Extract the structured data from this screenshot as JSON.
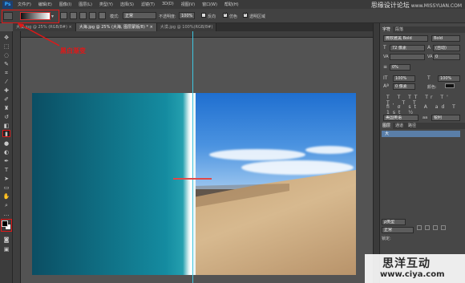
{
  "app": {
    "logo": "Ps"
  },
  "menu": [
    "文件(F)",
    "编辑(E)",
    "图像(I)",
    "图层(L)",
    "类型(Y)",
    "选择(S)",
    "滤镜(T)",
    "3D(D)",
    "视图(V)",
    "窗口(W)",
    "帮助(H)"
  ],
  "site_logo": {
    "name": "思缘设计论坛",
    "url": "www.MISSYUAN.COM"
  },
  "options": {
    "mode_label": "模式:",
    "mode_value": "正常",
    "opacity_label": "不透明度:",
    "opacity_value": "100%",
    "reverse_label": "反向",
    "dither_label": "仿色",
    "transparency_label": "透明区域"
  },
  "tabs": [
    {
      "label": "大漠.jpg @ 25% (RGB/8#) ×",
      "active": false
    },
    {
      "label": "大海.jpg @ 25% (大海, 图层蒙版/8) * ×",
      "active": true
    },
    {
      "label": "大漠.jpg @ 100%(RGB/8#)",
      "active": false
    }
  ],
  "annotation": {
    "text": "黑白渐变",
    "color": "#e01818"
  },
  "panel": {
    "tabs": [
      "字符",
      "段落"
    ],
    "font_family": "微软雅黑 Bold",
    "font_style": "Bold",
    "font_size": "72 像素",
    "leading": "(自动)",
    "tracking_label": "VA",
    "tracking_value": "0",
    "kerning_value": "0%",
    "scale_v": "100%",
    "scale_h": "100%",
    "baseline": "0 像素",
    "color_label": "颜色:",
    "lang": "美国英语",
    "aa_label": "aa",
    "aa_value": "锐利",
    "layer_tabs": [
      "图层",
      "通道",
      "路径"
    ],
    "layer_name": "大",
    "kind_label": "ρ类型",
    "blend_mode": "正常",
    "lock_label": "锁定:"
  },
  "watermark": {
    "title": "思洋互动",
    "url": "www.ciya.com"
  }
}
